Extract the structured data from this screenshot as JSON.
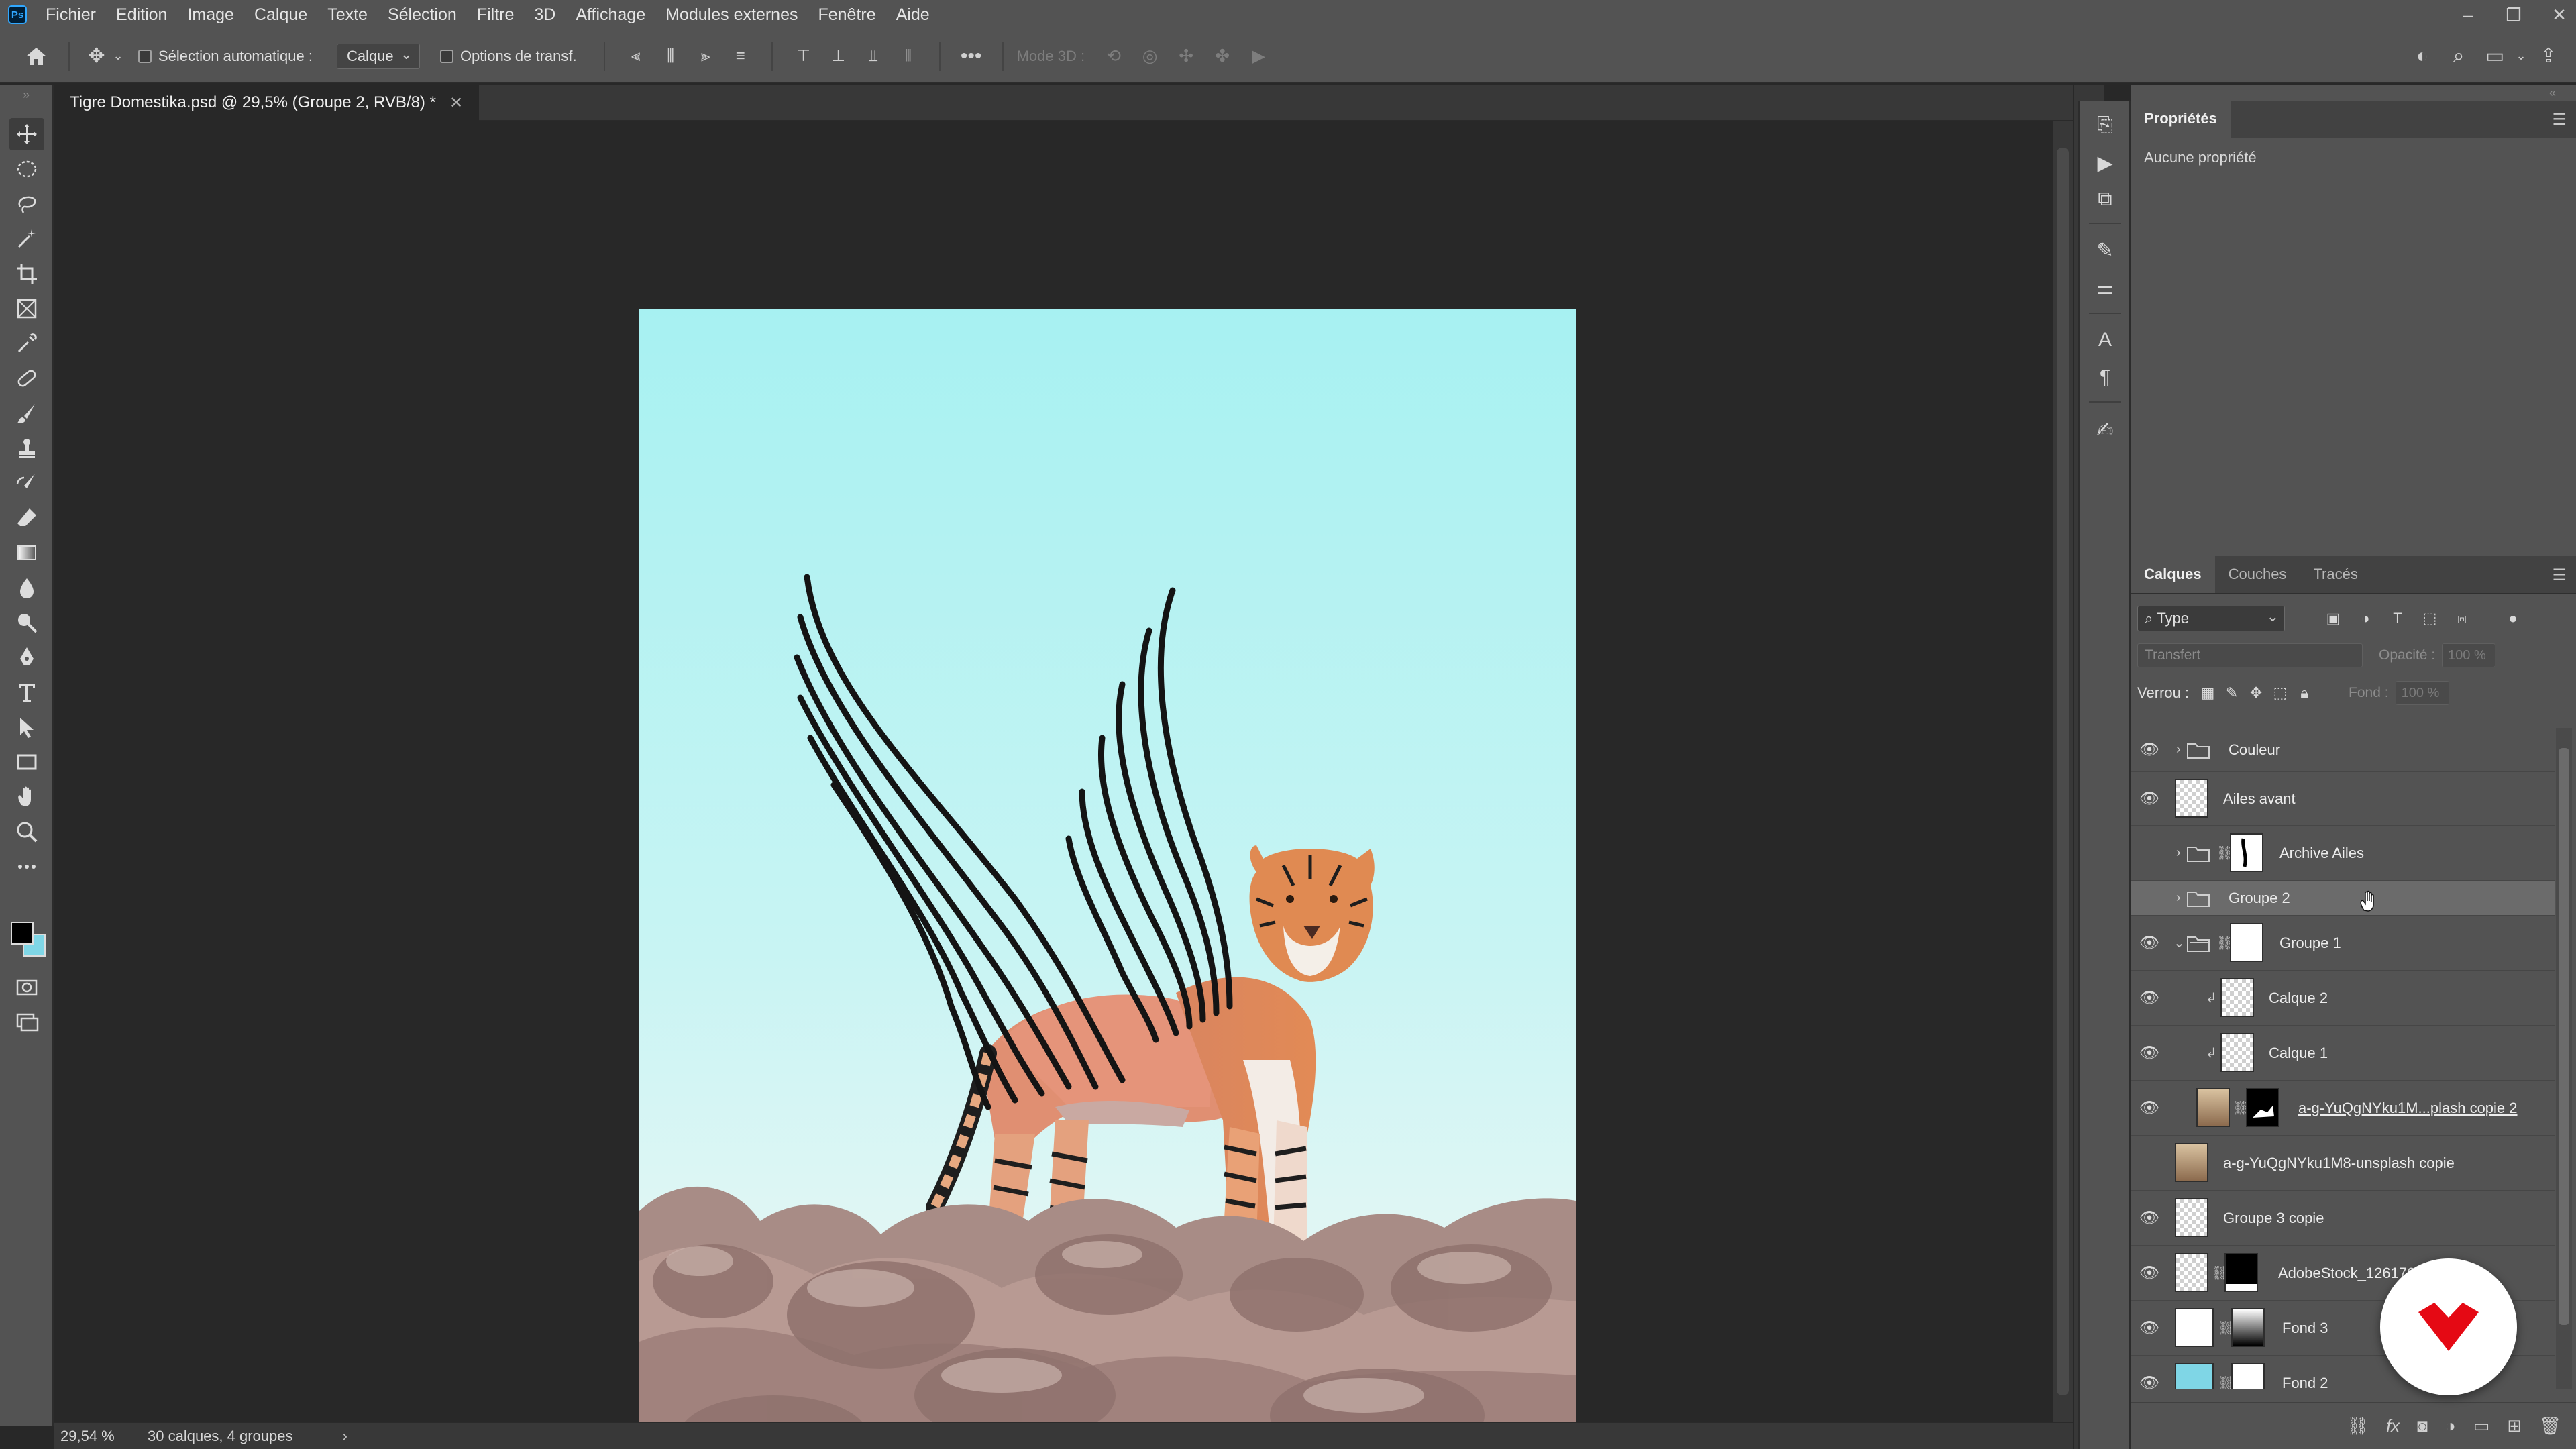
{
  "app": {
    "logo_text": "Ps"
  },
  "menubar": {
    "items": [
      "Fichier",
      "Edition",
      "Image",
      "Calque",
      "Texte",
      "Sélection",
      "Filtre",
      "3D",
      "Affichage",
      "Modules externes",
      "Fenêtre",
      "Aide"
    ]
  },
  "options_bar": {
    "auto_select_label": "Sélection automatique :",
    "auto_select_target": "Calque",
    "transform_options_label": "Options de transf.",
    "mode_3d_label": "Mode 3D :"
  },
  "document": {
    "tab_title": "Tigre Domestika.psd @ 29,5% (Groupe 2, RVB/8) *",
    "zoom": "29,54 %",
    "status_info": "30 calques, 4 groupes"
  },
  "properties_panel": {
    "tab": "Propriétés",
    "empty_text": "Aucune propriété"
  },
  "layers_panel": {
    "tabs": [
      "Calques",
      "Couches",
      "Tracés"
    ],
    "filter_kind": "Type",
    "blend_mode": "Transfert",
    "opacity_label": "Opacité :",
    "opacity_value": "100 %",
    "lock_label": "Verrou :",
    "fill_label": "Fond :",
    "fill_value": "100 %",
    "layers": [
      {
        "name": "Couleur",
        "visible": true,
        "type": "group",
        "expanded": false
      },
      {
        "name": "Ailes avant",
        "visible": true,
        "type": "layer"
      },
      {
        "name": "Archive Ailes",
        "visible": false,
        "type": "group-mask",
        "expanded": false
      },
      {
        "name": "Groupe 2",
        "visible": false,
        "type": "group",
        "expanded": false,
        "selected": true
      },
      {
        "name": "Groupe 1",
        "visible": true,
        "type": "group-mask",
        "expanded": true
      },
      {
        "name": "Calque 2",
        "visible": true,
        "type": "clipped"
      },
      {
        "name": "Calque 1",
        "visible": true,
        "type": "clipped"
      },
      {
        "name": "a-g-YuQgNYku1M...plash copie 2",
        "visible": true,
        "type": "photo-mask"
      },
      {
        "name": "a-g-YuQgNYku1M8-unsplash copie",
        "visible": false,
        "type": "photo"
      },
      {
        "name": "Groupe 3 copie",
        "visible": true,
        "type": "layer"
      },
      {
        "name": "AdobeStock_126176630",
        "visible": true,
        "type": "photo-mask"
      },
      {
        "name": "Fond 3",
        "visible": true,
        "type": "gradient-mask"
      },
      {
        "name": "Fond 2",
        "visible": true,
        "type": "color-mask"
      }
    ]
  },
  "colors": {
    "ui_dark": "#282828",
    "ui_panel": "#535353",
    "foreground": "#000000",
    "background": "#7fd6e6",
    "sky_top": "#a7f1f2",
    "brand_red": "#e50914"
  }
}
